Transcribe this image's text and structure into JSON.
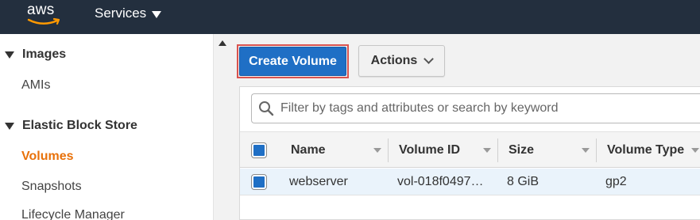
{
  "header": {
    "logo_text": "aws",
    "services_label": "Services"
  },
  "sidebar": {
    "sections": [
      {
        "label": "Images",
        "items": [
          {
            "label": "AMIs",
            "active": false
          }
        ]
      },
      {
        "label": "Elastic Block Store",
        "items": [
          {
            "label": "Volumes",
            "active": true
          },
          {
            "label": "Snapshots",
            "active": false
          },
          {
            "label": "Lifecycle Manager",
            "active": false
          }
        ]
      }
    ]
  },
  "toolbar": {
    "create_label": "Create Volume",
    "actions_label": "Actions"
  },
  "search": {
    "placeholder": "Filter by tags and attributes or search by keyword"
  },
  "table": {
    "columns": [
      "Name",
      "Volume ID",
      "Size",
      "Volume Type"
    ],
    "rows": [
      {
        "name": "webserver",
        "volume_id": "vol-018f0497…",
        "size": "8 GiB",
        "volume_type": "gp2"
      }
    ]
  },
  "colors": {
    "topbar": "#232f3e",
    "primary_button": "#1f6fc5",
    "highlight_outline": "#d9534f",
    "active_nav": "#e8710a",
    "selected_row": "#eaf3fb"
  },
  "icons": {
    "services_caret": "caret-down-icon",
    "section_toggle": "triangle-down-icon",
    "actions_chevron": "chevron-down-icon",
    "search": "search-icon",
    "sort": "sort-caret-icon"
  }
}
